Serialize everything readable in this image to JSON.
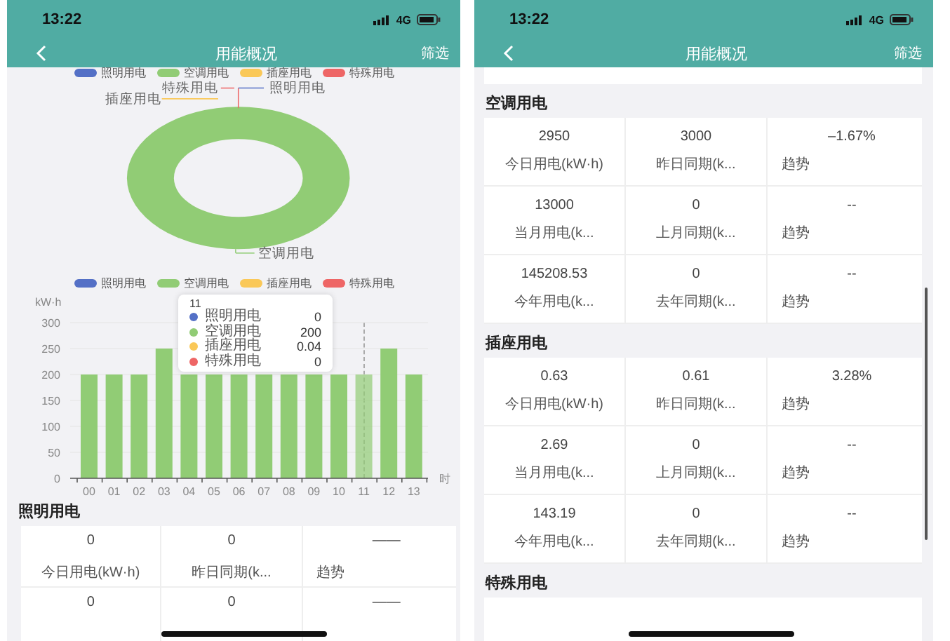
{
  "screens": [
    {
      "status": {
        "time": "13:22",
        "network": "4G"
      },
      "nav": {
        "title": "用能概况",
        "action": "筛选"
      },
      "donut": {
        "legend": [
          {
            "name": "照明用电",
            "color": "#5470c6"
          },
          {
            "name": "空调用电",
            "color": "#91cc75"
          },
          {
            "name": "插座用电",
            "color": "#fac858"
          },
          {
            "name": "特殊用电",
            "color": "#ee6666"
          }
        ],
        "labels": [
          "特殊用电",
          "照明用电",
          "插座用电",
          "空调用电"
        ]
      },
      "bar_chart": {
        "chart_data": {
          "type": "bar",
          "ylabel": "kW·h",
          "xlabel": "时",
          "stacked": true,
          "grid": true,
          "legend": true,
          "categories": [
            "00",
            "01",
            "02",
            "03",
            "04",
            "05",
            "06",
            "07",
            "08",
            "09",
            "10",
            "11",
            "12",
            "13"
          ],
          "series": [
            {
              "name": "照明用电",
              "color": "#5470c6",
              "values": [
                0,
                0,
                0,
                0,
                0,
                0,
                0,
                0,
                0,
                0,
                0,
                0,
                0,
                0
              ]
            },
            {
              "name": "空调用电",
              "color": "#91cc75",
              "values": [
                200,
                200,
                200,
                250,
                200,
                200,
                200,
                200,
                200,
                200,
                200,
                200,
                250,
                200
              ]
            },
            {
              "name": "插座用电",
              "color": "#fac858",
              "values": [
                0,
                0,
                0,
                0,
                0,
                0,
                0,
                0,
                0,
                0,
                0,
                0,
                0,
                0
              ]
            },
            {
              "name": "特殊用电",
              "color": "#ee6666",
              "values": [
                0,
                0,
                0,
                0,
                0,
                0,
                0,
                0,
                0,
                0,
                0,
                0,
                0,
                0
              ]
            }
          ],
          "ylim": [
            0,
            300
          ],
          "yticks": [
            0,
            50,
            100,
            150,
            200,
            250,
            300
          ]
        },
        "tooltip": {
          "title": "11",
          "items": [
            {
              "name": "照明用电",
              "value": "0",
              "color": "#5470c6"
            },
            {
              "name": "空调用电",
              "value": "200",
              "color": "#91cc75"
            },
            {
              "name": "插座用电",
              "value": "0.04",
              "color": "#fac858"
            },
            {
              "name": "特殊用电",
              "value": "0",
              "color": "#ee6666"
            }
          ]
        }
      },
      "sections": [
        {
          "title": "照明用电",
          "rows": [
            {
              "cells": [
                {
                  "value": "0",
                  "label": "今日用电(kW·h)"
                },
                {
                  "value": "0",
                  "label": "昨日同期(k..."
                },
                {
                  "value": "——",
                  "label": "趋势"
                }
              ]
            },
            {
              "cells": [
                {
                  "value": "0"
                },
                {
                  "value": "0"
                },
                {
                  "value": "——"
                }
              ]
            }
          ]
        }
      ]
    },
    {
      "status": {
        "time": "13:22",
        "network": "4G"
      },
      "nav": {
        "title": "用能概况",
        "action": "筛选"
      },
      "scrolled": true,
      "sections": [
        {
          "title": "空调用电",
          "rows": [
            {
              "cells": [
                {
                  "value": "2950",
                  "label": "今日用电(kW·h)"
                },
                {
                  "value": "3000",
                  "label": "昨日同期(k..."
                },
                {
                  "value": "–1.67%",
                  "label": "趋势"
                }
              ]
            },
            {
              "cells": [
                {
                  "value": "13000",
                  "label": "当月用电(k..."
                },
                {
                  "value": "0",
                  "label": "上月同期(k..."
                },
                {
                  "value": "--",
                  "label": "趋势"
                }
              ]
            },
            {
              "cells": [
                {
                  "value": "145208.53",
                  "label": "今年用电(k..."
                },
                {
                  "value": "0",
                  "label": "去年同期(k..."
                },
                {
                  "value": "--",
                  "label": "趋势"
                }
              ]
            }
          ]
        },
        {
          "title": "插座用电",
          "rows": [
            {
              "cells": [
                {
                  "value": "0.63",
                  "label": "今日用电(kW·h)"
                },
                {
                  "value": "0.61",
                  "label": "昨日同期(k..."
                },
                {
                  "value": "3.28%",
                  "label": "趋势"
                }
              ]
            },
            {
              "cells": [
                {
                  "value": "2.69",
                  "label": "当月用电(k..."
                },
                {
                  "value": "0",
                  "label": "上月同期(k..."
                },
                {
                  "value": "--",
                  "label": "趋势"
                }
              ]
            },
            {
              "cells": [
                {
                  "value": "143.19",
                  "label": "今年用电(k..."
                },
                {
                  "value": "0",
                  "label": "去年同期(k..."
                },
                {
                  "value": "--",
                  "label": "趋势"
                }
              ]
            }
          ]
        },
        {
          "title": "特殊用电",
          "cut": true
        }
      ]
    }
  ]
}
